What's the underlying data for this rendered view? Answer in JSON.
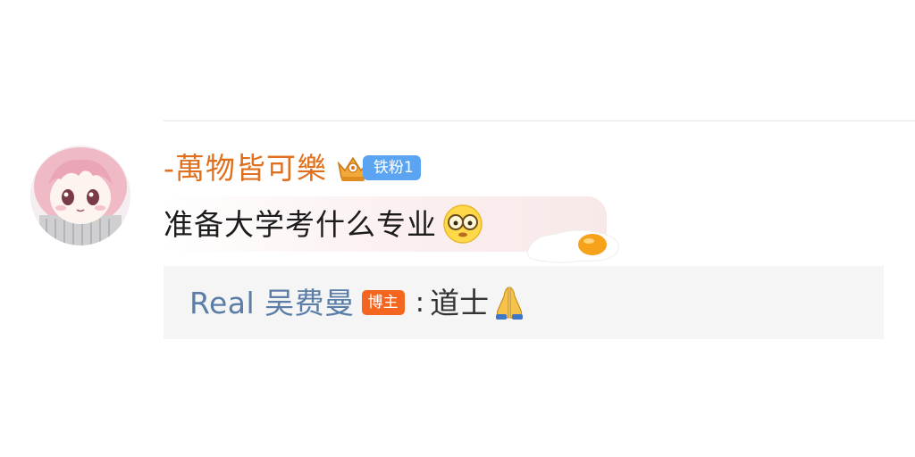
{
  "comment": {
    "username": "-萬物皆可樂",
    "fan_badge": "铁粉1",
    "text": "准备大学考什么专业",
    "icons": [
      "crown-icon",
      "glasses-emoji-icon",
      "fried-egg-icon"
    ],
    "colors": {
      "username": "#e0701e",
      "fan_badge": "#5aa4f2"
    }
  },
  "reply": {
    "user": "Real 吴费曼",
    "badge": "博主",
    "separator": ":",
    "text": "道士",
    "icons": [
      "pray-icon"
    ],
    "colors": {
      "user": "#5a7ea8",
      "badge": "#f4661f",
      "background": "#f5f5f5"
    }
  }
}
